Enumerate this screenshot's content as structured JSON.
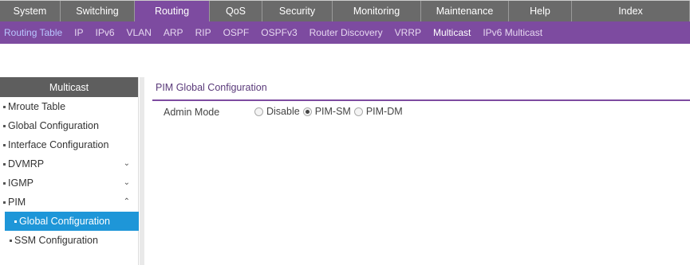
{
  "topnav": {
    "tabs": [
      {
        "label": "System",
        "width": 76
      },
      {
        "label": "Switching",
        "width": 93
      },
      {
        "label": "Routing",
        "width": 94,
        "active": true
      },
      {
        "label": "QoS",
        "width": 66
      },
      {
        "label": "Security",
        "width": 88
      },
      {
        "label": "Monitoring",
        "width": 111
      },
      {
        "label": "Maintenance",
        "width": 110
      },
      {
        "label": "Help",
        "width": 79
      },
      {
        "label": "Index",
        "width": 148
      }
    ]
  },
  "subnav": {
    "items": [
      {
        "label": "Routing Table"
      },
      {
        "label": "IP"
      },
      {
        "label": "IPv6"
      },
      {
        "label": "VLAN"
      },
      {
        "label": "ARP"
      },
      {
        "label": "RIP"
      },
      {
        "label": "OSPF"
      },
      {
        "label": "OSPFv3"
      },
      {
        "label": "Router Discovery"
      },
      {
        "label": "VRRP"
      },
      {
        "label": "Multicast",
        "active": true
      },
      {
        "label": "IPv6 Multicast"
      }
    ]
  },
  "sidebar": {
    "header": "Multicast",
    "items": [
      {
        "label": "Mroute Table",
        "chevron": ""
      },
      {
        "label": "Global Configuration",
        "chevron": ""
      },
      {
        "label": "Interface Configuration",
        "chevron": ""
      },
      {
        "label": "DVMRP",
        "chevron": "⌄"
      },
      {
        "label": "IGMP",
        "chevron": "⌄"
      },
      {
        "label": "PIM",
        "chevron": "⌃"
      },
      {
        "label": "Global Configuration",
        "chevron": "",
        "sub": true,
        "selected": true
      },
      {
        "label": "SSM Configuration",
        "chevron": "",
        "sub": true
      }
    ]
  },
  "main": {
    "section_title": "PIM Global Configuration",
    "admin_mode": {
      "label": "Admin Mode",
      "options": [
        {
          "label": "Disable",
          "checked": false
        },
        {
          "label": "PIM-SM",
          "checked": true
        },
        {
          "label": "PIM-DM",
          "checked": false
        }
      ]
    }
  },
  "colors": {
    "accent": "#7d4ba0",
    "selected": "#1e96d8",
    "nav_bg": "#6a6a6a"
  }
}
